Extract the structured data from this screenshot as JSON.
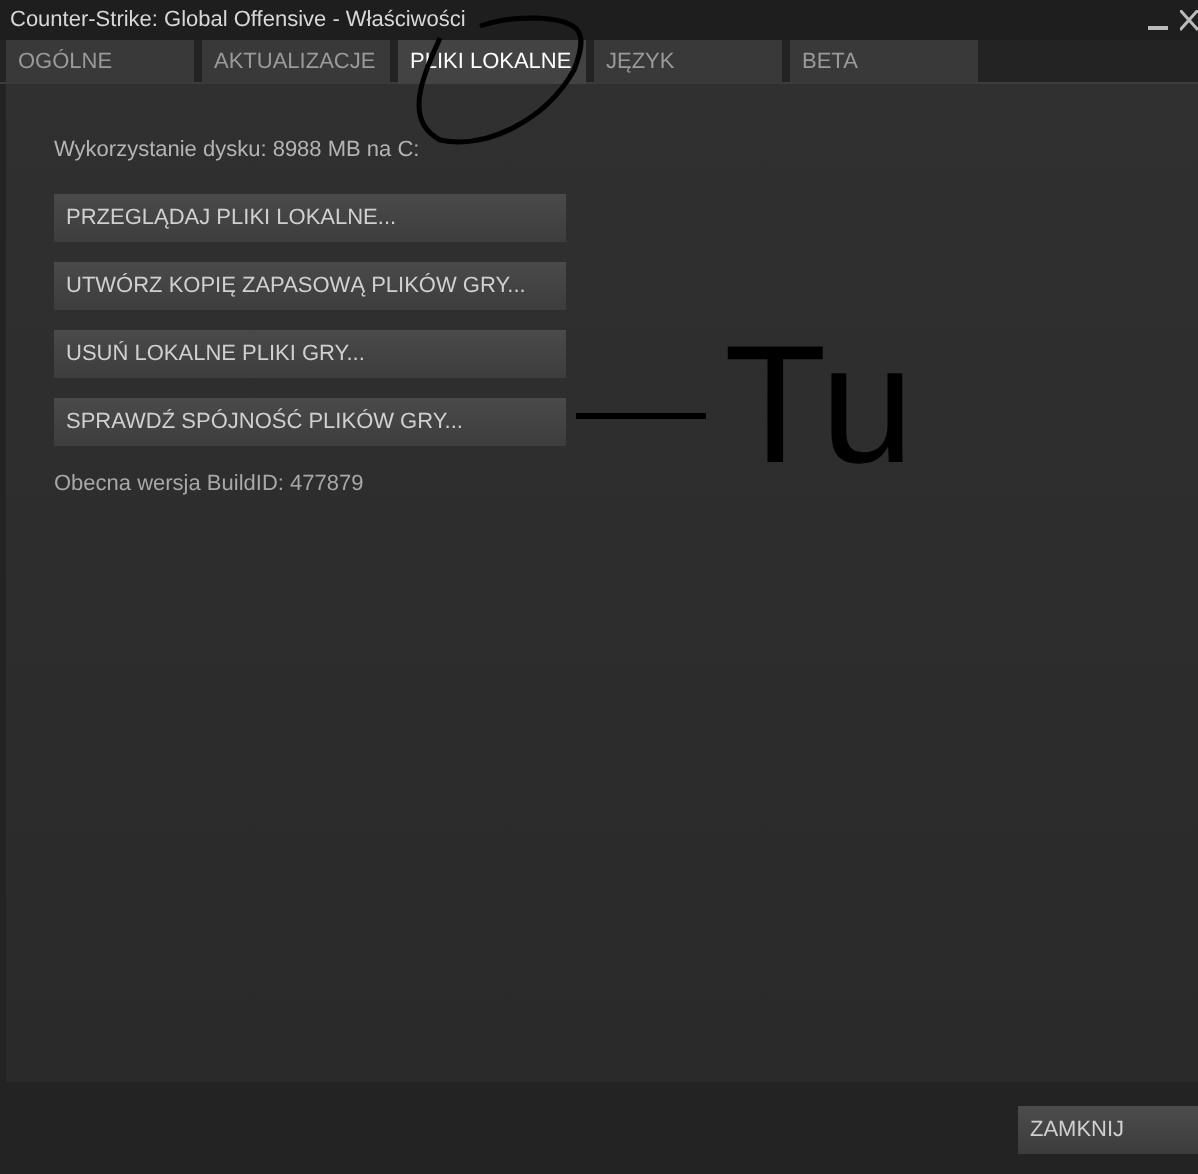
{
  "window": {
    "title": "Counter-Strike: Global Offensive - Właściwości"
  },
  "tabs": [
    {
      "label": "OGÓLNE",
      "selected": false
    },
    {
      "label": "AKTUALIZACJE",
      "selected": false
    },
    {
      "label": "PLIKI LOKALNE",
      "selected": true
    },
    {
      "label": "JĘZYK",
      "selected": false
    },
    {
      "label": "BETA",
      "selected": false
    }
  ],
  "disk_usage": "Wykorzystanie dysku: 8988 MB na C:",
  "buttons": [
    "PRZEGLĄDAJ PLIKI LOKALNE...",
    "UTWÓRZ KOPIĘ ZAPASOWĄ PLIKÓW GRY...",
    "USUŃ LOKALNE PLIKI GRY...",
    "SPRAWDŹ SPÓJNOŚĆ PLIKÓW GRY..."
  ],
  "build_id": "Obecna wersja BuildID: 477879",
  "annotation": {
    "text": "Tu"
  },
  "close_button": "ZAMKNIJ"
}
